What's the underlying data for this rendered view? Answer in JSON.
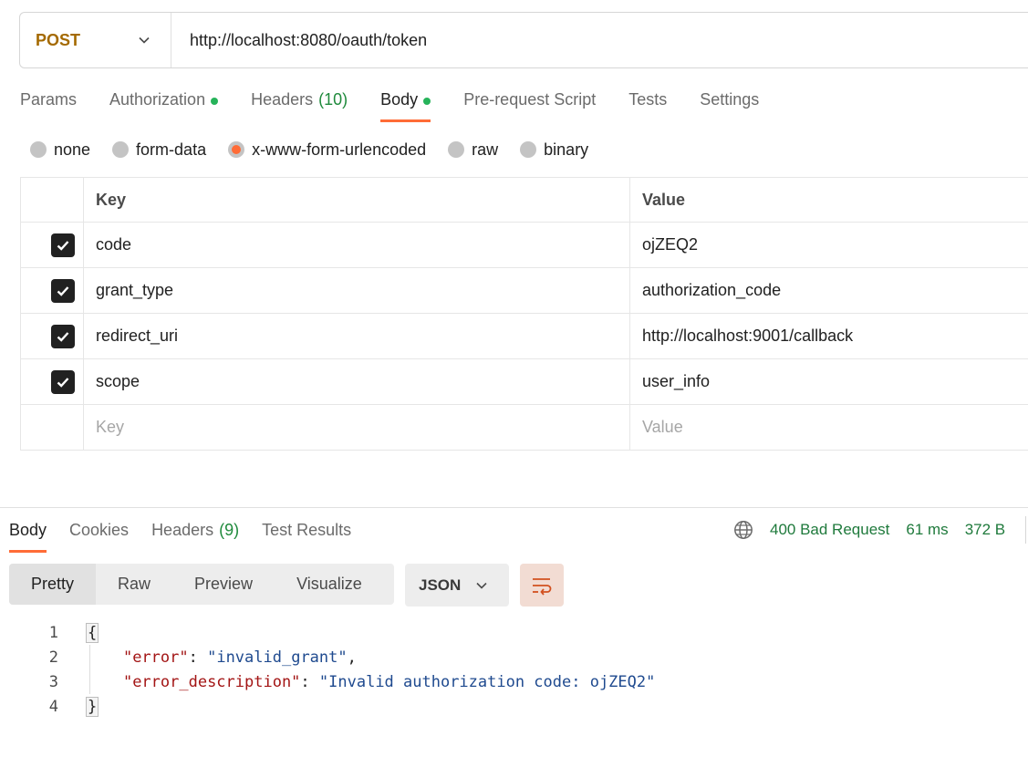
{
  "request": {
    "method": "POST",
    "url": "http://localhost:8080/oauth/token"
  },
  "request_tabs": [
    {
      "label": "Params"
    },
    {
      "label": "Authorization"
    },
    {
      "label": "Headers",
      "count": "(10)"
    },
    {
      "label": "Body"
    },
    {
      "label": "Pre-request Script"
    },
    {
      "label": "Tests"
    },
    {
      "label": "Settings"
    }
  ],
  "body_types": [
    {
      "label": "none"
    },
    {
      "label": "form-data"
    },
    {
      "label": "x-www-form-urlencoded",
      "selected": true
    },
    {
      "label": "raw"
    },
    {
      "label": "binary"
    }
  ],
  "kv_table": {
    "key_header": "Key",
    "value_header": "Value",
    "rows": [
      {
        "key": "code",
        "value": "ojZEQ2",
        "checked": true
      },
      {
        "key": "grant_type",
        "value": "authorization_code",
        "checked": true
      },
      {
        "key": "redirect_uri",
        "value": "http://localhost:9001/callback",
        "checked": true
      },
      {
        "key": "scope",
        "value": "user_info",
        "checked": true
      }
    ],
    "placeholder_key": "Key",
    "placeholder_value": "Value"
  },
  "response_tabs": [
    {
      "label": "Body"
    },
    {
      "label": "Cookies"
    },
    {
      "label": "Headers",
      "count": "(9)"
    },
    {
      "label": "Test Results"
    }
  ],
  "response_status": {
    "status": "400 Bad Request",
    "time": "61 ms",
    "size": "372 B"
  },
  "view_modes": [
    "Pretty",
    "Raw",
    "Preview",
    "Visualize"
  ],
  "format": "JSON",
  "code": {
    "line_numbers": [
      "1",
      "2",
      "3",
      "4"
    ],
    "open_brace": "{",
    "close_brace": "}",
    "key1": "\"error\"",
    "val1": "\"invalid_grant\"",
    "key2": "\"error_description\"",
    "val2": "\"Invalid authorization code: ojZEQ2\""
  },
  "colors": {
    "accent": "#ff6c37",
    "method": "#a46a00",
    "status_ok_dot": "#26b35a",
    "status_text": "#1f7a3c"
  }
}
